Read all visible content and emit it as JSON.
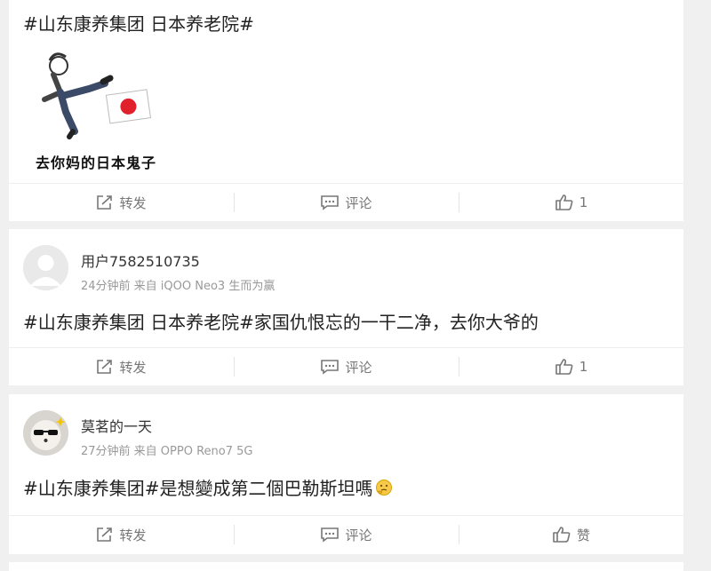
{
  "posts": [
    {
      "text": "#山东康养集团 日本养老院#",
      "image_caption": "去你妈的日本鬼子",
      "actions": {
        "repost": "转发",
        "comment": "评论",
        "like": "1"
      }
    },
    {
      "user": {
        "name": "用户7582510735",
        "meta": "24分钟前 来自 iQOO Neo3 生而为赢"
      },
      "text": "#山东康养集团 日本养老院#家国仇恨忘的一干二净，去你大爷的",
      "actions": {
        "repost": "转发",
        "comment": "评论",
        "like": "1"
      }
    },
    {
      "user": {
        "name": "莫茗的一天",
        "meta": "27分钟前 来自 OPPO Reno7 5G"
      },
      "text": "#山东康养集团#是想變成第二個巴勒斯坦嗎",
      "emoji": "thinking-emoji",
      "actions": {
        "repost": "转发",
        "comment": "评论",
        "like": "赞"
      }
    }
  ],
  "icons": {
    "repost": "share-icon",
    "comment": "comment-icon",
    "like": "thumbs-up-icon"
  }
}
